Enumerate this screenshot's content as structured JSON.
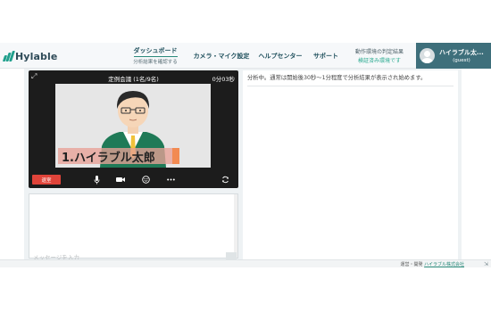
{
  "brand": {
    "name": "Hylable"
  },
  "nav": {
    "dashboard": {
      "label": "ダッシュボード",
      "sub": "分析結果を確認する"
    },
    "camera_mic": {
      "label": "カメラ・マイク設定"
    },
    "help": {
      "label": "ヘルプセンター"
    },
    "support": {
      "label": "サポート"
    },
    "env_check": {
      "label": "動作環境の判定結果",
      "status": "検証済み環境です"
    }
  },
  "user": {
    "name": "ハイラブル太...",
    "role": "(guest)"
  },
  "meeting": {
    "title": "定例会議 (1名/9名)",
    "elapsed": "0分03秒",
    "participant_label": "1.ハイラブル太郎",
    "exit_label": "退室"
  },
  "chat": {
    "placeholder": "メッセージを入力"
  },
  "analysis": {
    "message": "分析中。通常は開始後30秒〜1分程度で分析結果が表示され始めます。"
  },
  "footer": {
    "prefix": "運営・開発",
    "company": "ハイラブル株式会社"
  },
  "colors": {
    "accent": "#3e6f7b",
    "brand": "#1f9f8c",
    "exit": "#e0443a",
    "verified": "#29a98f"
  }
}
